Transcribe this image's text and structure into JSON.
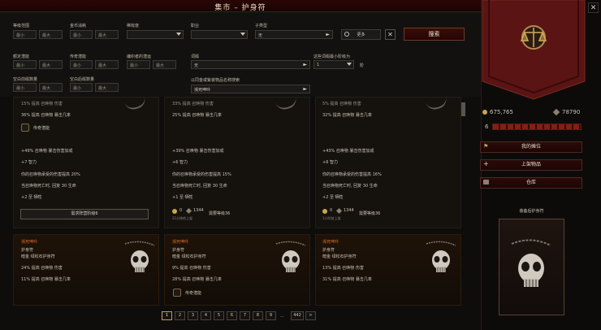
{
  "window": {
    "title": "集市 – 护身符"
  },
  "filters": {
    "level_range": {
      "label": "等级范围",
      "min": "最小",
      "max": "最大"
    },
    "legendary_count": {
      "label": "金币消耗",
      "min": "最小",
      "max": "最大"
    },
    "rarity": {
      "label": "稀有度",
      "value": ""
    },
    "class": {
      "label": "职业",
      "value": ""
    },
    "subtype": {
      "label": "子类型",
      "value": "无"
    },
    "more_button": "更多",
    "search_button": "搜索",
    "gold_potential": {
      "label": "额定潜能",
      "min": "最小",
      "max": "最大"
    },
    "legend_potential": {
      "label": "传奇潜能",
      "min": "最小",
      "max": "最大"
    },
    "thread_count": {
      "label": "编织者的潜运",
      "min": "最小",
      "max": "最大"
    },
    "empty_frames": {
      "label": "空白前缀数量",
      "min": "最小",
      "max": "最大"
    },
    "empty_suffix": {
      "label": "空白后缀数量",
      "min": "最小",
      "max": "最大"
    },
    "affix": {
      "label": "词缀",
      "value": "无"
    },
    "affix_min_level": {
      "label": "这些词缀最小阶级为",
      "value": "1",
      "suffix": "阶"
    },
    "name_search": {
      "label": "以同金或紫装物品名称搜索",
      "value": "濒死呻吟"
    }
  },
  "cards_top": [
    {
      "partial": "15% 提高 召唤物 伤害",
      "crit": "36% 提高 召唤物 暴击几率",
      "legend": "传奇潜能",
      "lines": [
        "+49% 召唤物 暴击伤害加成",
        "+7 智力",
        "你的召唤物承受的伤害提高 20%",
        "当召唤物死亡时, 回复 30 生命",
        "+2 至 牺牲"
      ],
      "req_label": "需求阵营阶级6"
    },
    {
      "partial": "33% 提高 召唤物 伤害",
      "crit": "25% 提高 召唤物 暴击几率",
      "lines": [
        "+39% 召唤物 暴击伤害加成",
        "+6 智力",
        "你的召唤物承受的伤害提高 15%",
        "当召唤物死亡时, 回复 30 生命",
        "+1 至 牺牲"
      ],
      "stock": "0",
      "price": "1344",
      "time": "21分钟前上架",
      "req": "需要等级36"
    },
    {
      "partial": "5% 提高 召唤物 伤害",
      "crit": "32% 提高 召唤物 暴击几率",
      "lines": [
        "+43% 召唤物 暴击伤害加成",
        "+6 智力",
        "你的召唤物承受的伤害提高 16%",
        "当召唤物死亡时, 回复 30 生命",
        "+2 至 牺牲"
      ],
      "stock": "0",
      "price": "1344",
      "time": "1小时前上架",
      "req": "需要等级36"
    }
  ],
  "cards_bottom": [
    {
      "name": "濒死呻吟",
      "type": "护身符",
      "sub": "暗金 绿松石护身符",
      "dmg": "24% 提高 召唤物 伤害",
      "crit": "11% 提高 召唤物 暴击几率"
    },
    {
      "name": "濒死呻吟",
      "type": "护身符",
      "sub": "暗金 绿松石护身符",
      "dmg": "9% 提高 召唤物 伤害",
      "crit": "28% 提高 召唤物 暴击几率",
      "legend": "传奇潜能"
    },
    {
      "name": "濒死呻吟",
      "type": "护身符",
      "sub": "暗金 绿松石护身符",
      "dmg": "13% 提高 召唤物 伤害",
      "crit": "31% 提高 召唤物 暴击几率"
    }
  ],
  "pagination": [
    "1",
    "2",
    "3",
    "4",
    "5",
    "6",
    "7",
    "8",
    "9",
    "...",
    "442",
    ">"
  ],
  "side": {
    "gold": "675,765",
    "currency": "78790",
    "level": "6",
    "my_stall": "我的摊位",
    "list_item": "上架物品",
    "storage": "仓库",
    "equipped_label": "装备后护身符"
  },
  "colors": {
    "accent": "#d06a2a",
    "banner": "#5a1414"
  }
}
